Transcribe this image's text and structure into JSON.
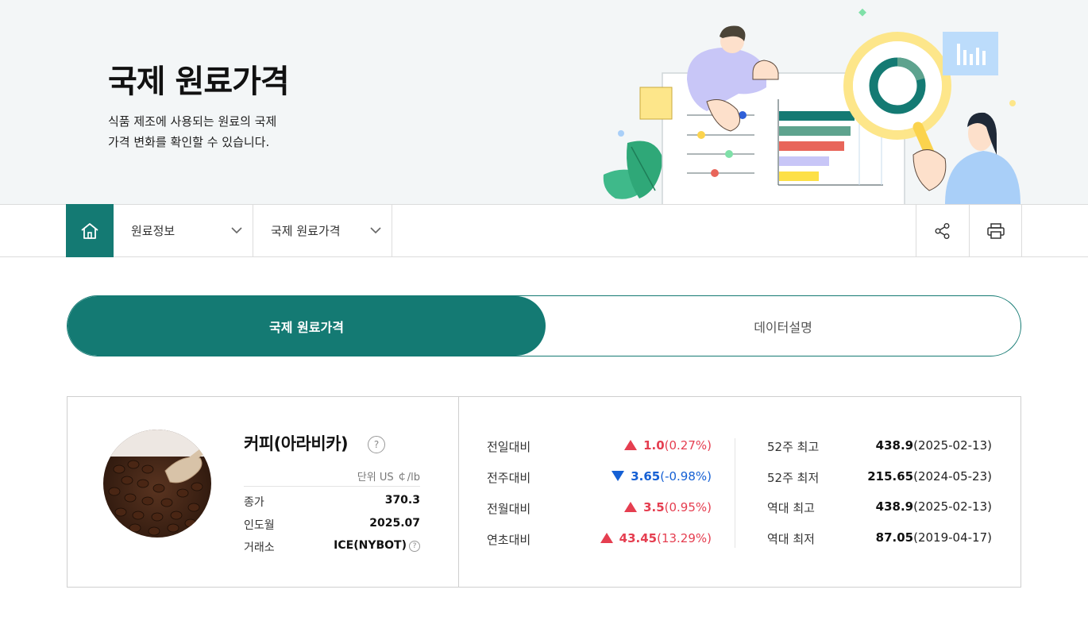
{
  "hero": {
    "title": "국제 원료가격",
    "desc_line1": "식품 제조에 사용되는 원료의 국제",
    "desc_line2": "가격 변화를 확인할 수 있습니다."
  },
  "nav": {
    "home_icon": "home-icon",
    "dropdown1": "원료정보",
    "dropdown2": "국제 원료가격",
    "share_icon": "share-icon",
    "print_icon": "print-icon",
    "accent": "#147a73"
  },
  "tabs": [
    {
      "label": "국제 원료가격",
      "active": true
    },
    {
      "label": "데이터설명",
      "active": false
    }
  ],
  "item": {
    "name": "커피(아라비카)",
    "help": "?",
    "unit": "단위 US ￠/lb",
    "rows": [
      {
        "label": "종가",
        "value": "370.3"
      },
      {
        "label": "인도월",
        "value": "2025.07"
      },
      {
        "label": "거래소",
        "value": "ICE(NYBOT)"
      }
    ]
  },
  "changes": [
    {
      "label": "전일대비",
      "direction": "up",
      "amount": "1.0",
      "pct": "(0.27%)"
    },
    {
      "label": "전주대비",
      "direction": "down",
      "amount": "3.65",
      "pct": "(-0.98%)"
    },
    {
      "label": "전월대비",
      "direction": "up",
      "amount": "3.5",
      "pct": "(0.95%)"
    },
    {
      "label": "연초대비",
      "direction": "up",
      "amount": "43.45",
      "pct": "(13.29%)"
    }
  ],
  "extremes": [
    {
      "label": "52주 최고",
      "value": "438.9",
      "date": "(2025-02-13)"
    },
    {
      "label": "52주 최저",
      "value": "215.65",
      "date": "(2024-05-23)"
    },
    {
      "label": "역대 최고",
      "value": "438.9",
      "date": "(2025-02-13)"
    },
    {
      "label": "역대 최저",
      "value": "87.05",
      "date": "(2019-04-17)"
    }
  ],
  "colors": {
    "up": "#e53e50",
    "down": "#1560d4"
  }
}
